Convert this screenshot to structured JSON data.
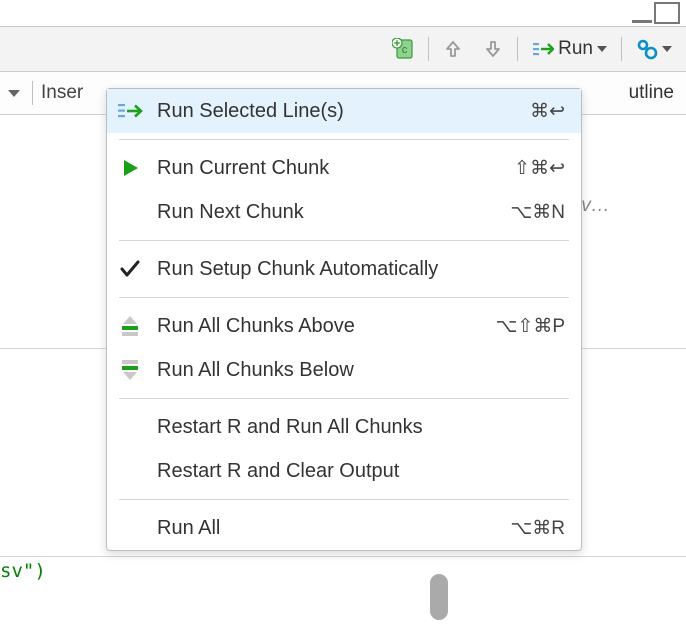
{
  "toolbar": {
    "run_label": "Run",
    "insert_label": "Inser",
    "outline_label": "utline"
  },
  "code_hint": "ine av…",
  "code_fragment": "sv\")",
  "menu": {
    "items": [
      {
        "label": "Run Selected Line(s)",
        "shortcut": "⌘↩"
      },
      {
        "label": "Run Current Chunk",
        "shortcut": "⇧⌘↩"
      },
      {
        "label": "Run Next Chunk",
        "shortcut": "⌥⌘N"
      },
      {
        "label": "Run Setup Chunk Automatically",
        "shortcut": ""
      },
      {
        "label": "Run All Chunks Above",
        "shortcut": "⌥⇧⌘P"
      },
      {
        "label": "Run All Chunks Below",
        "shortcut": ""
      },
      {
        "label": "Restart R and Run All Chunks",
        "shortcut": ""
      },
      {
        "label": "Restart R and Clear Output",
        "shortcut": ""
      },
      {
        "label": "Run All",
        "shortcut": "⌥⌘R"
      }
    ]
  }
}
